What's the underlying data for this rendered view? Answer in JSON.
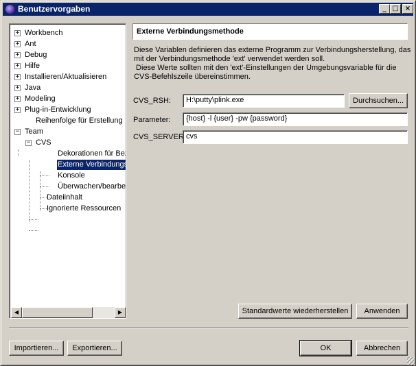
{
  "window": {
    "title": "Benutzervorgaben",
    "minimize_glyph": "_",
    "maximize_glyph": "□",
    "close_glyph": "×"
  },
  "tree": {
    "items": [
      {
        "label": "Workbench",
        "expander": "+"
      },
      {
        "label": "Ant",
        "expander": "+"
      },
      {
        "label": "Debug",
        "expander": "+"
      },
      {
        "label": "Hilfe",
        "expander": "+"
      },
      {
        "label": "Installieren/Aktualisieren",
        "expander": "+"
      },
      {
        "label": "Java",
        "expander": "+"
      },
      {
        "label": "Modeling",
        "expander": "+"
      },
      {
        "label": "Plug-in-Entwicklung",
        "expander": "+"
      },
      {
        "label": "Reihenfolge für Erstellung",
        "expander": ""
      },
      {
        "label": "Team",
        "expander": "−"
      },
      {
        "label": "CVS",
        "expander": "−"
      },
      {
        "label": "Dekorationen für Beze",
        "expander": ""
      },
      {
        "label": "Externe Verbindungsm",
        "expander": "",
        "selected": true
      },
      {
        "label": "Konsole",
        "expander": ""
      },
      {
        "label": "Überwachen/bearbeite",
        "expander": ""
      },
      {
        "label": "Dateiinhalt",
        "expander": ""
      },
      {
        "label": "Ignorierte Ressourcen",
        "expander": ""
      }
    ],
    "scroll_left_glyph": "◀",
    "scroll_right_glyph": "▶"
  },
  "page": {
    "title": "Externe Verbindungsmethode",
    "description": [
      "Diese Variablen definieren das externe Programm zur Verbindungsherstellung, das",
      "mit der Verbindungsmethode 'ext' verwendet werden soll.",
      " Diese Werte sollten mit den 'ext'-Einstellungen der Umgebungsvariable für die",
      "CVS-Befehlszeile übereinstimmen."
    ],
    "fields": {
      "cvs_rsh_label": "CVS_RSH:",
      "cvs_rsh_value": "H:\\putty\\plink.exe",
      "browse_label": "Durchsuchen...",
      "parameter_label": "Parameter:",
      "parameter_value": "{host} -l {user} -pw {password}",
      "cvs_server_label": "CVS_SERVER:",
      "cvs_server_value": "cvs"
    },
    "restore_defaults_label": "Standardwerte wiederherstellen",
    "apply_label": "Anwenden"
  },
  "footer": {
    "import_label": "Importieren...",
    "export_label": "Exportieren...",
    "ok_label": "OK",
    "cancel_label": "Abbrechen"
  }
}
